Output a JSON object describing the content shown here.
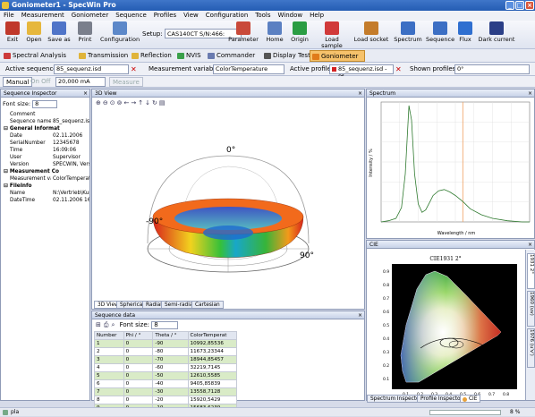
{
  "window": {
    "title": "Goniometer1 - SpecWin Pro"
  },
  "menu": [
    "File",
    "Measurement",
    "Goniometer",
    "Sequence",
    "Profiles",
    "View",
    "Configuration",
    "Tools",
    "Window",
    "Help"
  ],
  "toolbar": {
    "buttons": [
      {
        "label": "Exit",
        "icon": "exit-icon",
        "color": "#c0392b"
      },
      {
        "label": "Open",
        "icon": "open-folder-icon",
        "color": "#e6b73d"
      },
      {
        "label": "Save as",
        "icon": "save-icon",
        "color": "#4f74c8"
      },
      {
        "label": "Print",
        "icon": "printer-icon",
        "color": "#7a7f8c"
      },
      {
        "label": "Configuration",
        "icon": "configuration-icon",
        "color": "#5c88c9"
      },
      {
        "label": "Parameter",
        "icon": "parameter-icon",
        "color": "#c94a3a"
      },
      {
        "label": "Home",
        "icon": "home-icon",
        "color": "#5b80c2"
      },
      {
        "label": "Origin",
        "icon": "origin-icon",
        "color": "#2a9d43"
      },
      {
        "label": "Load sample",
        "icon": "load-sample-icon",
        "color": "#d13a3a"
      },
      {
        "label": "Load socket",
        "icon": "load-socket-icon",
        "color": "#c47c2b"
      },
      {
        "label": "Spectrum",
        "icon": "spectrum-icon",
        "color": "#3c6fc4"
      },
      {
        "label": "Sequence",
        "icon": "sequence-icon",
        "color": "#3c6fc4"
      },
      {
        "label": "Flux",
        "icon": "flux-icon",
        "color": "#2f6fd0"
      },
      {
        "label": "Dark current",
        "icon": "dark-current-icon",
        "color": "#2b3f87"
      }
    ],
    "setup_label": "Setup:",
    "setup_value": "CAS140CT S/N:466:"
  },
  "modes": [
    {
      "label": "Spectral Analysis",
      "color": "#cc3a3a"
    },
    {
      "label": "Transmission",
      "color": "#e0b43a"
    },
    {
      "label": "Reflection",
      "color": "#e0b43a"
    },
    {
      "label": "NVIS",
      "color": "#3aa04a"
    },
    {
      "label": "Commander",
      "color": "#6a7bb0"
    },
    {
      "label": "Display Test",
      "color": "#555"
    },
    {
      "label": "Goniometer",
      "color": "#e07b1a"
    }
  ],
  "sequencebar": {
    "active_sequence_label": "Active sequence:",
    "active_sequence_value": "85_sequenz.isd",
    "measurement_variable_label": "Measurement variable:",
    "measurement_variable_value": "ColorTemperature",
    "active_profile_label": "Active profile:",
    "active_profile_value": "85_sequenz.isd - Pf",
    "shown_profiles_label": "Shown profiles:",
    "shown_profiles_value": "0°"
  },
  "manualbar": {
    "manual_label": "Manual",
    "onoff_label": "On  Off",
    "current_value": "20,000 mA",
    "measure_label": "Measure"
  },
  "inspector": {
    "title": "Sequence Inspector",
    "font_label": "Font size:",
    "font_value": "8",
    "rows": [
      {
        "k": "Comment",
        "v": "",
        "indent": true
      },
      {
        "k": "Sequence name",
        "v": "85_sequenz.isd",
        "indent": true
      },
      {
        "k": "General Informat",
        "v": "",
        "header": true
      },
      {
        "k": "Date",
        "v": "02.11.2006",
        "indent": true
      },
      {
        "k": "SerialNumber",
        "v": "12345678",
        "indent": true
      },
      {
        "k": "Time",
        "v": "16:09:06",
        "indent": true
      },
      {
        "k": "User",
        "v": "Supervisor",
        "indent": true
      },
      {
        "k": "Version",
        "v": "SPECWIN, Version",
        "indent": true
      },
      {
        "k": "Measurement Co",
        "v": "",
        "header": true
      },
      {
        "k": "Measurement var",
        "v": "ColorTemperature",
        "indent": true
      },
      {
        "k": "FileInfo",
        "v": "",
        "header": true
      },
      {
        "k": "Name",
        "v": "N:\\Vertrieb\\Kunden",
        "indent": true
      },
      {
        "k": "DateTime",
        "v": "02.11.2006 16:09",
        "indent": true
      }
    ]
  },
  "view3d": {
    "title": "3D View",
    "labels": {
      "top": "0°",
      "left": "-90°",
      "right": "90°"
    },
    "tabs": [
      "3D View",
      "Spherical",
      "Radial",
      "Semi-radial",
      "Cartesian"
    ]
  },
  "seqdata": {
    "title": "Sequence data",
    "font_label": "Font size:",
    "font_value": "8",
    "columns": [
      "Number",
      "Phi / °",
      "Theta / °",
      "ColorTemperat"
    ],
    "rows": [
      [
        "1",
        "0",
        "-90",
        "10992,85536"
      ],
      [
        "2",
        "0",
        "-80",
        "11673,23344"
      ],
      [
        "3",
        "0",
        "-70",
        "18944,85457"
      ],
      [
        "4",
        "0",
        "-60",
        "32219,7145"
      ],
      [
        "5",
        "0",
        "-50",
        "12610,5585"
      ],
      [
        "6",
        "0",
        "-40",
        "9405,85839"
      ],
      [
        "7",
        "0",
        "-30",
        "13558,7128"
      ],
      [
        "8",
        "0",
        "-20",
        "15920,5429"
      ],
      [
        "9",
        "0",
        "-10",
        "15683,6239"
      ]
    ]
  },
  "spectrum": {
    "title": "Spectrum",
    "xlabel": "Wavelength / nm",
    "ylabel": "Intensity / %"
  },
  "cie": {
    "title": "CIE",
    "chart_title": "CIE1931 2°",
    "yticks": [
      "0.9",
      "0.8",
      "0.7",
      "0.6",
      "0.5",
      "0.4",
      "0.3",
      "0.2",
      "0.1"
    ],
    "xticks": [
      "0.1",
      "0.2",
      "0.3",
      "0.4",
      "0.5",
      "0.6",
      "0.7",
      "0.8"
    ],
    "side_tabs": [
      "1931 2°",
      "1960 (uv)",
      "1976 (u'v')"
    ]
  },
  "righttabs": [
    "Spectrum Inspector",
    "Profile Inspector",
    "CIE"
  ],
  "status": {
    "left": "pla",
    "right": "8 %"
  },
  "chart_data": {
    "type": "line",
    "title": "",
    "xlabel": "Wavelength / nm",
    "ylabel": "Intensity / %",
    "x": [
      380,
      400,
      420,
      435,
      445,
      455,
      462,
      470,
      480,
      490,
      500,
      510,
      520,
      535,
      550,
      565,
      580,
      600,
      620,
      650,
      680,
      720,
      760,
      780
    ],
    "series": [
      {
        "values": [
          0,
          1,
          3,
          12,
          40,
          97,
          85,
          40,
          15,
          8,
          10,
          16,
          22,
          26,
          27,
          25,
          22,
          17,
          11,
          6,
          3,
          1,
          0,
          0
        ]
      }
    ],
    "marker_x": 600,
    "grid": true,
    "legend": "none"
  }
}
